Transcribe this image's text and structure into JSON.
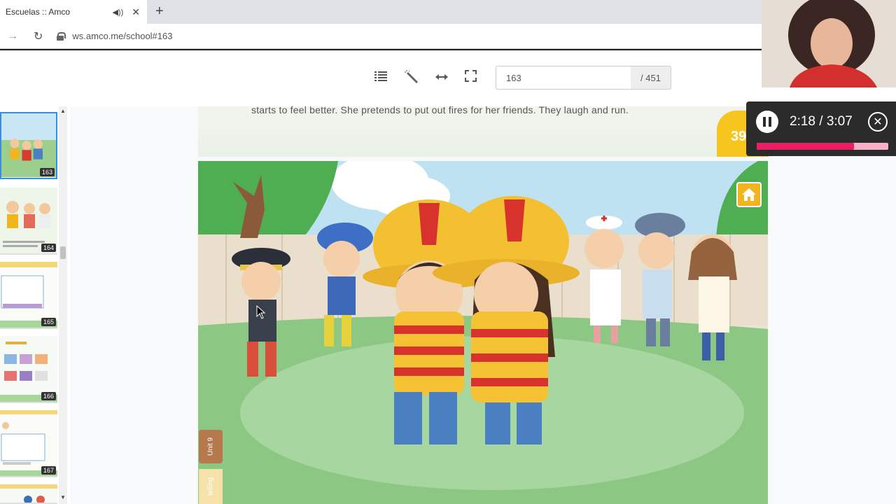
{
  "browser": {
    "tab_title": "Escuelas :: Amco",
    "mute_icon": "speaker-icon",
    "tab_close": "✕",
    "new_tab": "+",
    "url": "ws.amco.me/school#163"
  },
  "viewer": {
    "page_current": "163",
    "page_total": "/ 451",
    "tools": [
      "list-icon",
      "magic-wand-icon",
      "fit-width-icon",
      "fullscreen-icon"
    ]
  },
  "thumbnails": [
    {
      "page": "163",
      "active": true
    },
    {
      "page": "164",
      "active": false
    },
    {
      "page": "165",
      "active": false
    },
    {
      "page": "166",
      "active": false
    },
    {
      "page": "167",
      "active": false
    }
  ],
  "book": {
    "story_text": "starts to feel better. She pretends to put out fires for her friends. They laugh and run.",
    "page_badge": "39",
    "unit_tab": "Unit 9",
    "telling_tab": "telling"
  },
  "player": {
    "time": "2:18 / 3:07",
    "progress": 0.74
  },
  "colors": {
    "accent": "#e91e63",
    "badge": "#f6c61f",
    "active_thumb": "#3a8fd8"
  }
}
